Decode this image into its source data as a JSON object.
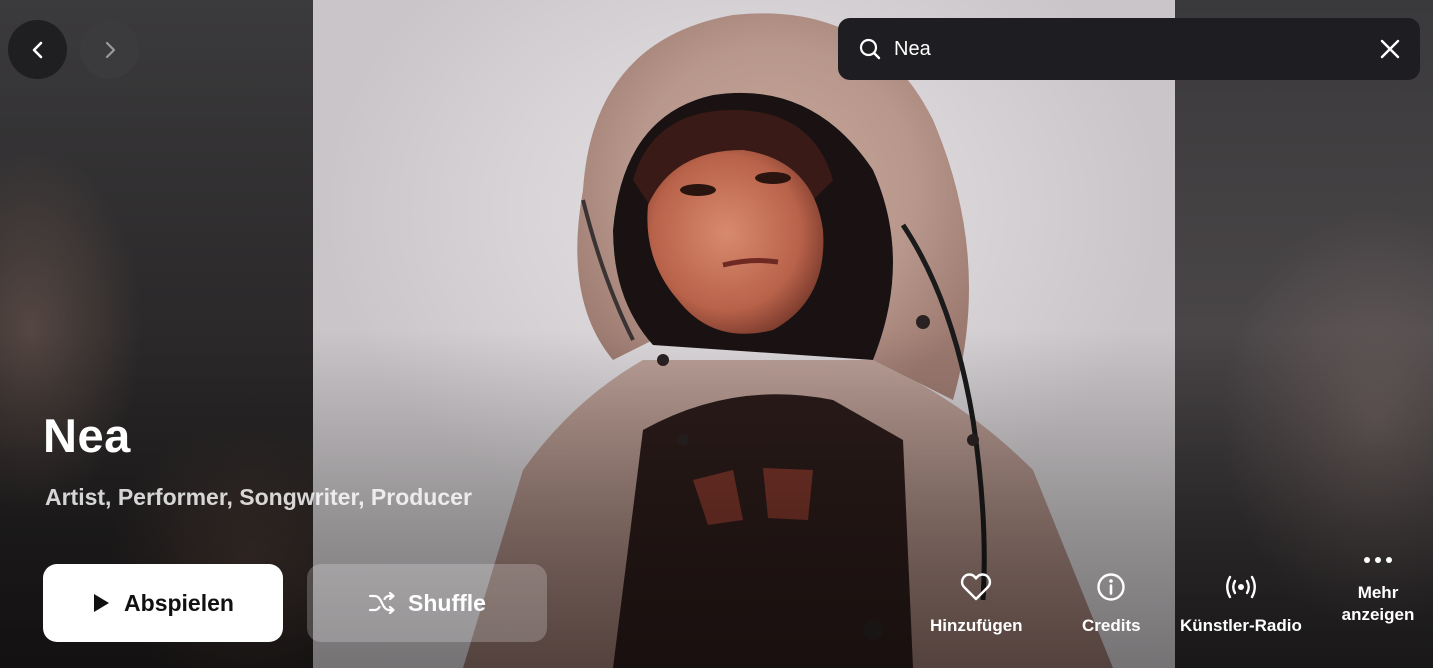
{
  "navigation": {
    "back_icon": "chevron-left-icon",
    "forward_icon": "chevron-right-icon"
  },
  "search": {
    "value": "Nea",
    "icon": "search-icon",
    "clear_icon": "close-icon"
  },
  "artist": {
    "name": "Nea",
    "roles": "Artist, Performer, Songwriter, Producer"
  },
  "buttons": {
    "play_label": "Abspielen",
    "shuffle_label": "Shuffle"
  },
  "actions": [
    {
      "label": "Hinzufügen",
      "icon": "heart-icon"
    },
    {
      "label": "Credits",
      "icon": "info-icon"
    },
    {
      "label": "Künstler-Radio",
      "icon": "radio-icon"
    },
    {
      "label": "Mehr anzeigen",
      "icon": "more-icon"
    }
  ],
  "colors": {
    "search_bg": "#1e1e22",
    "play_bg": "#ffffff",
    "text": "#ffffff"
  }
}
